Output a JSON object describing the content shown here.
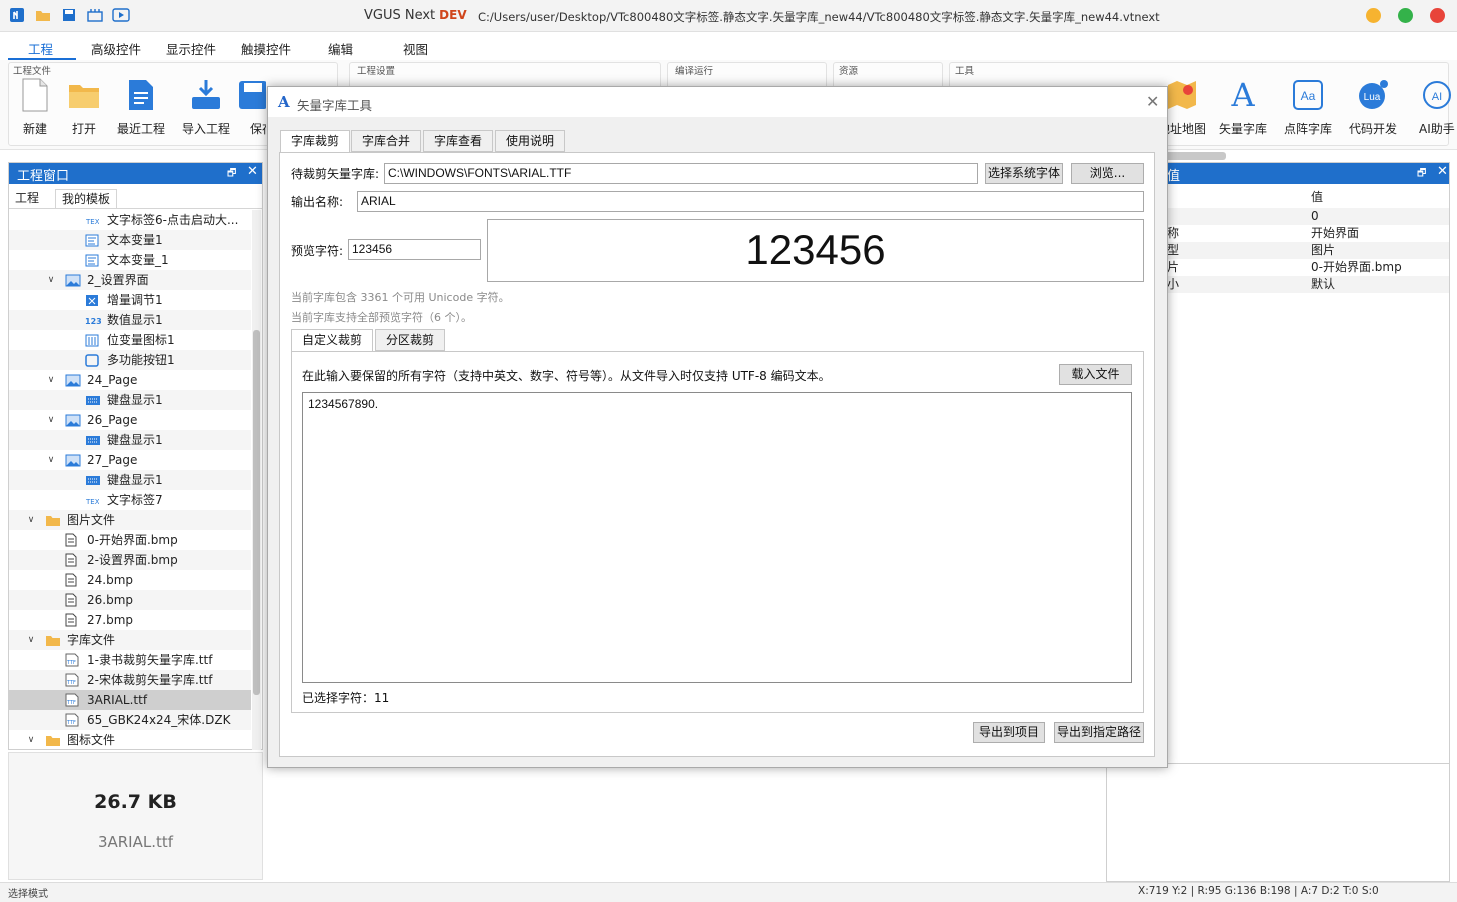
{
  "app": {
    "title": "VGUS Next",
    "edition": "DEV",
    "path": "C:/Users/user/Desktop/VTc800480文字标签.静态文字.矢量字库_new44/VTc800480文字标签.静态文字.矢量字库_new44.vtnext"
  },
  "colors": {
    "accent": "#1f6fcb",
    "dev": "#d0451b",
    "dot_yellow": "#f6b330",
    "dot_green": "#34b24a",
    "dot_red": "#e8443a"
  },
  "menu": [
    "工程",
    "高级控件",
    "显示控件",
    "触摸控件",
    "编辑",
    "视图"
  ],
  "ribbon": {
    "groups": [
      "工程文件",
      "工程设置",
      "编译运行",
      "资源",
      "工具"
    ],
    "buttons": [
      "新建",
      "打开",
      "最近工程",
      "导入工程",
      "保存"
    ],
    "right_buttons": [
      "地址地图",
      "矢量字库",
      "点阵字库",
      "代码开发",
      "AI助手"
    ]
  },
  "left_panel": {
    "title": "工程窗口",
    "tabs": [
      "工程",
      "我的模板"
    ],
    "tree": [
      {
        "label": "文字标签6-点击启动大...",
        "icon": "text-label-icon"
      },
      {
        "label": "文本变量1",
        "icon": "text-var-icon"
      },
      {
        "label": "文本变量_1",
        "icon": "text-var-icon"
      },
      {
        "label": "2_设置界面",
        "icon": "page-icon"
      },
      {
        "label": "增量调节1",
        "icon": "increment-icon"
      },
      {
        "label": "数值显示1",
        "icon": "number-icon"
      },
      {
        "label": "位变量图标1",
        "icon": "bit-icon"
      },
      {
        "label": "多功能按钮1",
        "icon": "button-icon"
      },
      {
        "label": "24_Page",
        "icon": "page-icon"
      },
      {
        "label": "键盘显示1",
        "icon": "keyboard-icon"
      },
      {
        "label": "26_Page",
        "icon": "page-icon"
      },
      {
        "label": "键盘显示1",
        "icon": "keyboard-icon"
      },
      {
        "label": "27_Page",
        "icon": "page-icon"
      },
      {
        "label": "键盘显示1",
        "icon": "keyboard-icon"
      },
      {
        "label": "文字标签7",
        "icon": "text-label-icon"
      },
      {
        "label": "图片文件",
        "icon": "folder-icon"
      },
      {
        "label": "0-开始界面.bmp",
        "icon": "file-icon"
      },
      {
        "label": "2-设置界面.bmp",
        "icon": "file-icon"
      },
      {
        "label": "24.bmp",
        "icon": "file-icon"
      },
      {
        "label": "26.bmp",
        "icon": "file-icon"
      },
      {
        "label": "27.bmp",
        "icon": "file-icon"
      },
      {
        "label": "字库文件",
        "icon": "folder-icon"
      },
      {
        "label": "1-隶书裁剪矢量字库.ttf",
        "icon": "font-file-icon"
      },
      {
        "label": "2-宋体裁剪矢量字库.ttf",
        "icon": "font-file-icon"
      },
      {
        "label": "3ARIAL.ttf",
        "icon": "font-file-icon"
      },
      {
        "label": "65_GBK24x24_宋体.DZK",
        "icon": "font-file-icon"
      },
      {
        "label": "图标文件",
        "icon": "folder-icon"
      }
    ]
  },
  "file_info": {
    "size": "26.7 KB",
    "name": "3ARIAL.ttf"
  },
  "right_panel": {
    "header_col": "值",
    "rows": [
      {
        "key": "",
        "value": "0"
      },
      {
        "key": "称",
        "value": "开始界面"
      },
      {
        "key": "型",
        "value": "图片"
      },
      {
        "key": "片",
        "value": "0-开始界面.bmp"
      },
      {
        "key": "小",
        "value": "默认"
      }
    ]
  },
  "status": {
    "left": "选择模式",
    "right": "X:719  Y:2  |  R:95 G:136 B:198  |  A:7  D:2  T:0  S:0"
  },
  "dialog": {
    "title": "矢量字库工具",
    "tabs": [
      "字库裁剪",
      "字库合并",
      "字库查看",
      "使用说明"
    ],
    "source_label": "待裁剪矢量字库:",
    "source_value": "C:\\WINDOWS\\FONTS\\ARIAL.TTF",
    "select_system_font": "选择系统字体",
    "browse": "浏览...",
    "output_label": "输出名称:",
    "output_value": "ARIAL",
    "preview_label": "预览字符:",
    "preview_value": "123456",
    "preview_render": "123456",
    "info1": "当前字库包含 3361 个可用 Unicode 字符。",
    "info2": "当前字库支持全部预览字符（6 个）。",
    "sub_tabs": [
      "自定义裁剪",
      "分区裁剪"
    ],
    "instruction": "在此输入要保留的所有字符（支持中英文、数字、符号等）。从文件导入时仅支持 UTF-8 编码文本。",
    "load_file": "载入文件",
    "chars": "1234567890.",
    "selected_count": "已选择字符：11",
    "export_project": "导出到项目",
    "export_path": "导出到指定路径"
  }
}
